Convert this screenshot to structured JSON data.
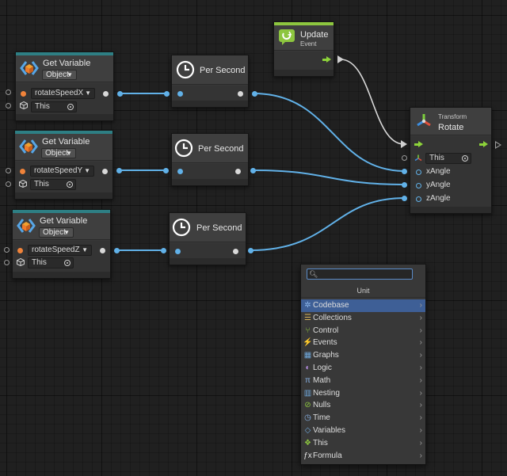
{
  "get_variable_nodes": [
    {
      "title": "Get Variable",
      "kind": "Object",
      "variable": "rotateSpeedX",
      "target": "This"
    },
    {
      "title": "Get Variable",
      "kind": "Object",
      "variable": "rotateSpeedY",
      "target": "This"
    },
    {
      "title": "Get Variable",
      "kind": "Object",
      "variable": "rotateSpeedZ",
      "target": "This"
    }
  ],
  "per_second_nodes": [
    {
      "title": "Per Second"
    },
    {
      "title": "Per Second"
    },
    {
      "title": "Per Second"
    }
  ],
  "update_event": {
    "title": "Update",
    "subtitle": "Event"
  },
  "transform_rotate": {
    "category": "Transform",
    "title": "Rotate",
    "target": "This",
    "ports": [
      "xAngle",
      "yAngle",
      "zAngle"
    ]
  },
  "fuzzy_finder": {
    "search_value": "",
    "header": "Unit",
    "items": [
      {
        "label": "Codebase",
        "icon": "gear-icon",
        "glyph": "✲",
        "color": "#8ab4e8"
      },
      {
        "label": "Collections",
        "icon": "list-icon",
        "glyph": "☰",
        "color": "#d8b35a"
      },
      {
        "label": "Control",
        "icon": "branch-icon",
        "glyph": "⑂",
        "color": "#8dc63f"
      },
      {
        "label": "Events",
        "icon": "bolt-icon",
        "glyph": "⚡",
        "color": "#f2c94c"
      },
      {
        "label": "Graphs",
        "icon": "graph-icon",
        "glyph": "▦",
        "color": "#6fa8dc"
      },
      {
        "label": "Logic",
        "icon": "logic-icon",
        "glyph": "◐",
        "color": "#b48ce0"
      },
      {
        "label": "Math",
        "icon": "pi-icon",
        "glyph": "π",
        "color": "#8ab4e8"
      },
      {
        "label": "Nesting",
        "icon": "nesting-icon",
        "glyph": "▥",
        "color": "#6fa8dc"
      },
      {
        "label": "Nulls",
        "icon": "null-icon",
        "glyph": "⊘",
        "color": "#8dc63f"
      },
      {
        "label": "Time",
        "icon": "clock-icon",
        "glyph": "◷",
        "color": "#8ab4e8"
      },
      {
        "label": "Variables",
        "icon": "variables-icon",
        "glyph": "◇",
        "color": "#6fa8dc"
      },
      {
        "label": "This",
        "icon": "this-icon",
        "glyph": "❖",
        "color": "#8dc63f"
      },
      {
        "label": "Formula",
        "icon": "formula-icon",
        "glyph": "ƒx",
        "color": "#e6e6e6"
      }
    ],
    "selected_index": 0
  }
}
